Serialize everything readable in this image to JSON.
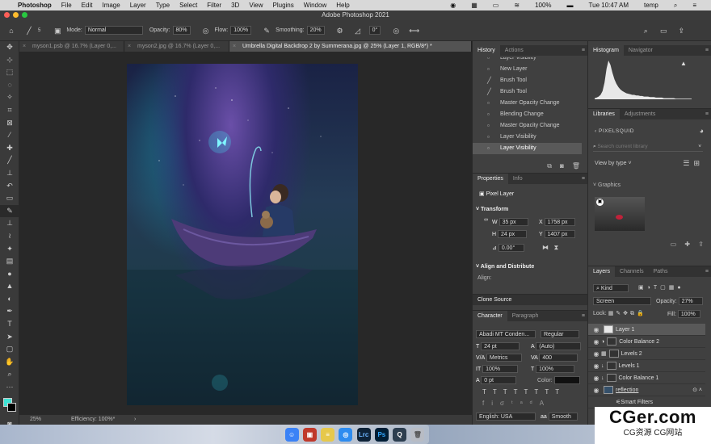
{
  "menubar": {
    "app": "Photoshop",
    "items": [
      "File",
      "Edit",
      "Image",
      "Layer",
      "Type",
      "Select",
      "Filter",
      "3D",
      "View",
      "Plugins",
      "Window",
      "Help"
    ],
    "battery": "100%",
    "clock": "Tue 10:47 AM",
    "user": "temp"
  },
  "window": {
    "title": "Adobe Photoshop 2021"
  },
  "options": {
    "brush_size": "5",
    "mode_label": "Mode:",
    "mode": "Normal",
    "opacity_label": "Opacity:",
    "opacity": "80%",
    "flow_label": "Flow:",
    "flow": "100%",
    "smoothing_label": "Smoothing:",
    "smoothing": "20%",
    "angle": "0°"
  },
  "doc_tabs": [
    {
      "label": "myson1.psb @ 16.7% (Layer 0,..."
    },
    {
      "label": "myson2.jpg @ 16.7% (Layer 0,..."
    },
    {
      "label": "Umbrella Digital Backdrop 2 by Summerana.jpg @ 25% (Layer 1, RGB/8*) *"
    }
  ],
  "status": {
    "zoom": "25%",
    "info": "Efficiency: 100%*"
  },
  "history": {
    "tabs": [
      "History",
      "Actions"
    ],
    "items": [
      "Layer Visibility",
      "New Layer",
      "Brush Tool",
      "Brush Tool",
      "Master Opacity Change",
      "Blending Change",
      "Master Opacity Change",
      "Layer Visibility",
      "Layer Visibility"
    ]
  },
  "properties": {
    "tabs": [
      "Properties",
      "Info"
    ],
    "kind": "Pixel Layer",
    "transform_title": "Transform",
    "w_label": "W",
    "w": "35 px",
    "x_label": "X",
    "x": "1758 px",
    "h_label": "H",
    "h": "24 px",
    "y_label": "Y",
    "y": "1407 px",
    "angle": "0.00°",
    "align_title": "Align and Distribute",
    "align_label": "Align:"
  },
  "clone_source": {
    "title": "Clone Source"
  },
  "character": {
    "tabs": [
      "Character",
      "Paragraph"
    ],
    "font": "Abadi MT Conden...",
    "style": "Regular",
    "size": "24 pt",
    "leading": "(Auto)",
    "kerning": "Metrics",
    "tracking": "400",
    "vscale": "100%",
    "hscale": "100%",
    "baseline": "0 pt",
    "color_label": "Color:",
    "lang": "English: USA",
    "aa": "Smooth"
  },
  "histogram": {
    "tabs": [
      "Histogram",
      "Navigator"
    ],
    "levels": [
      2,
      3,
      5,
      8,
      15,
      30,
      55,
      70,
      62,
      48,
      36,
      28,
      22,
      18,
      15,
      13,
      11,
      10,
      9,
      8,
      8,
      7,
      7,
      6,
      6,
      5,
      5,
      5,
      4,
      4,
      4,
      3,
      3,
      3,
      3,
      2,
      2,
      2,
      2,
      2,
      2,
      1,
      1,
      1,
      1,
      1,
      1,
      1,
      1,
      1
    ]
  },
  "libraries": {
    "tabs": [
      "Libraries",
      "Adjustments"
    ],
    "library": "PIXELSQUID",
    "search_placeholder": "Search current library",
    "view": "View by type",
    "section": "Graphics"
  },
  "layers": {
    "tabs": [
      "Layers",
      "Channels",
      "Paths"
    ],
    "filter": "Kind",
    "blend": "Screen",
    "opacity_label": "Opacity:",
    "opacity": "27%",
    "lock_label": "Lock:",
    "fill_label": "Fill:",
    "fill": "100%",
    "items": [
      {
        "name": "Layer 1"
      },
      {
        "name": "Color Balance 2"
      },
      {
        "name": "Levels 2"
      },
      {
        "name": "Levels 1"
      },
      {
        "name": "Color Balance 1"
      },
      {
        "name": "reflection"
      },
      {
        "name": "Smart Filters"
      }
    ]
  },
  "dock": {
    "apps": [
      "Finder",
      "Photo Booth",
      "Notes",
      "Safari",
      "Lrc",
      "Ps",
      "QuickTime",
      "Trash"
    ]
  },
  "watermark": {
    "brand": "CGer.com",
    "sub": "CG资源 CG网站"
  }
}
